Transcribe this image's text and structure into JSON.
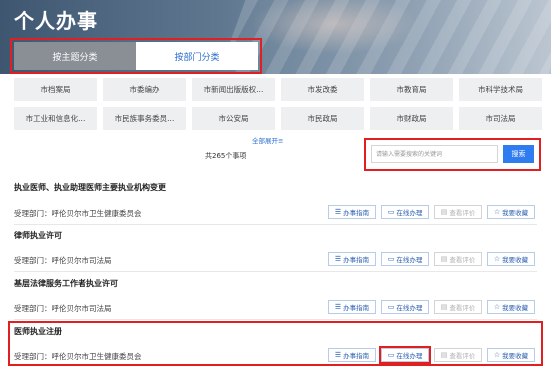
{
  "header": {
    "title": "个人办事"
  },
  "tabs": [
    {
      "label": "按主题分类",
      "active": false
    },
    {
      "label": "按部门分类",
      "active": true
    }
  ],
  "departments": [
    "市档案局",
    "市委编办",
    "市新闻出版版权...",
    "市发改委",
    "市教育局",
    "市科学技术局",
    "市工业和信息化...",
    "市民族事务委员...",
    "市公安局",
    "市民政局",
    "市财政局",
    "市司法局"
  ],
  "expand_label": "全部展开≡",
  "total_text": "共265个事项",
  "search": {
    "placeholder": "请输入需要搜索的关键词",
    "button": "搜索"
  },
  "action_labels": {
    "guide": "办事指南",
    "online": "在线办理",
    "evaluate": "查看评价",
    "favorite": "我要收藏"
  },
  "icons": {
    "guide": "list-icon",
    "online": "monitor-icon",
    "evaluate": "comment-icon",
    "favorite": "star-icon"
  },
  "items": [
    {
      "title": "执业医师、执业助理医师主要执业机构变更",
      "department": "受理部门：呼伦贝尔市卫生健康委员会"
    },
    {
      "title": "律师执业许可",
      "department": "受理部门：呼伦贝尔市司法局"
    },
    {
      "title": "基层法律服务工作者执业许可",
      "department": "受理部门：呼伦贝尔市司法局"
    },
    {
      "title": "医师执业注册",
      "department": "受理部门：呼伦贝尔市卫生健康委员会"
    }
  ],
  "colors": {
    "accent": "#2f7cf0",
    "highlight": "#e02020",
    "tab_inactive": "#8a8f96"
  }
}
